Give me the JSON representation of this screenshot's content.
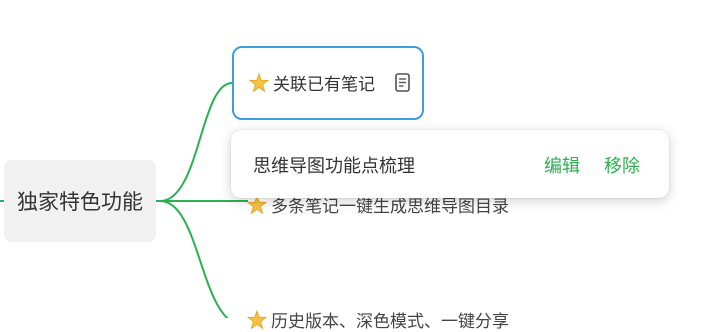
{
  "mindmap": {
    "central_topic": "独家特色功能",
    "branches": [
      {
        "label": "关联已有笔记",
        "icon": "star-icon",
        "has_note": true,
        "note_icon": "note-icon",
        "selected": true
      },
      {
        "label": "多条笔记一键生成思维导图目录",
        "icon": "star-icon"
      },
      {
        "label": "历史版本、深色模式、一键分享",
        "icon": "star-icon"
      }
    ],
    "colors": {
      "branch_line": "#2bb14f",
      "selection_border": "#3d9de2",
      "central_bg": "#f1f1f1",
      "action_text": "#2bb14f"
    }
  },
  "note_popup": {
    "linked_note_title": "思维导图功能点梳理",
    "edit_label": "编辑",
    "remove_label": "移除"
  }
}
